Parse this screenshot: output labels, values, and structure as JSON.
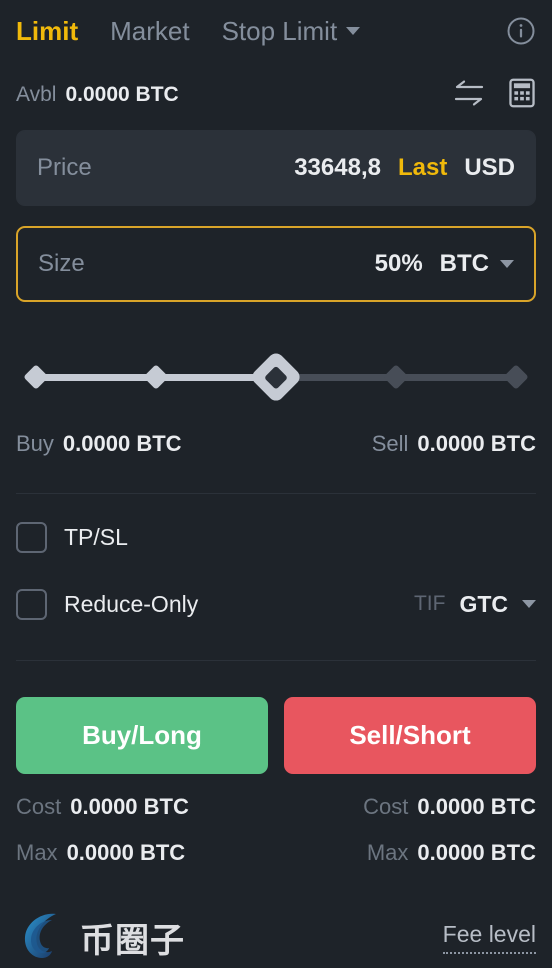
{
  "theme": {
    "background": "#1e2329",
    "field_bg": "#2b3139",
    "accent": "#f0b90b",
    "accent_border": "#d9a429",
    "text_primary": "#eaecef",
    "text_muted": "#848e9c",
    "buy_green": "#5bc286",
    "sell_red": "#e8565f",
    "slider_filled": "#c6cbd4",
    "slider_empty": "#474d57"
  },
  "tabs": [
    {
      "label": "Limit",
      "active": true
    },
    {
      "label": "Market",
      "active": false
    },
    {
      "label": "Stop Limit",
      "active": false,
      "has_caret": true
    }
  ],
  "header": {
    "info_icon": "info-circle-icon"
  },
  "available": {
    "label": "Avbl",
    "value": "0.0000 BTC",
    "swap_icon": "swap-arrows-icon",
    "calculator_icon": "calculator-icon"
  },
  "price_field": {
    "placeholder": "Price",
    "value": "33648,8",
    "mode": "Last",
    "currency": "USD"
  },
  "size_field": {
    "placeholder": "Size",
    "value": "50%",
    "unit": "BTC",
    "caret_icon": "chevron-down-icon"
  },
  "slider": {
    "value": 50,
    "stops": [
      0,
      25,
      50,
      75,
      100
    ]
  },
  "summary": {
    "buy_label": "Buy",
    "buy_value": "0.0000 BTC",
    "sell_label": "Sell",
    "sell_value": "0.0000 BTC"
  },
  "options": {
    "tpsl_label": "TP/SL",
    "tpsl_checked": false,
    "reduce_only_label": "Reduce-Only",
    "reduce_only_checked": false,
    "tif_label": "TIF",
    "tif_value": "GTC"
  },
  "actions": {
    "buy_label": "Buy/Long",
    "sell_label": "Sell/Short"
  },
  "buy_info": {
    "cost_label": "Cost",
    "cost_value": "0.0000 BTC",
    "max_label": "Max",
    "max_value": "0.0000 BTC"
  },
  "sell_info": {
    "cost_label": "Cost",
    "cost_value": "0.0000 BTC",
    "max_label": "Max",
    "max_value": "0.0000 BTC"
  },
  "footer": {
    "watermark_text": "币圈子",
    "watermark_logo": "spiral-circle-logo",
    "fee_level_label": "Fee level"
  }
}
